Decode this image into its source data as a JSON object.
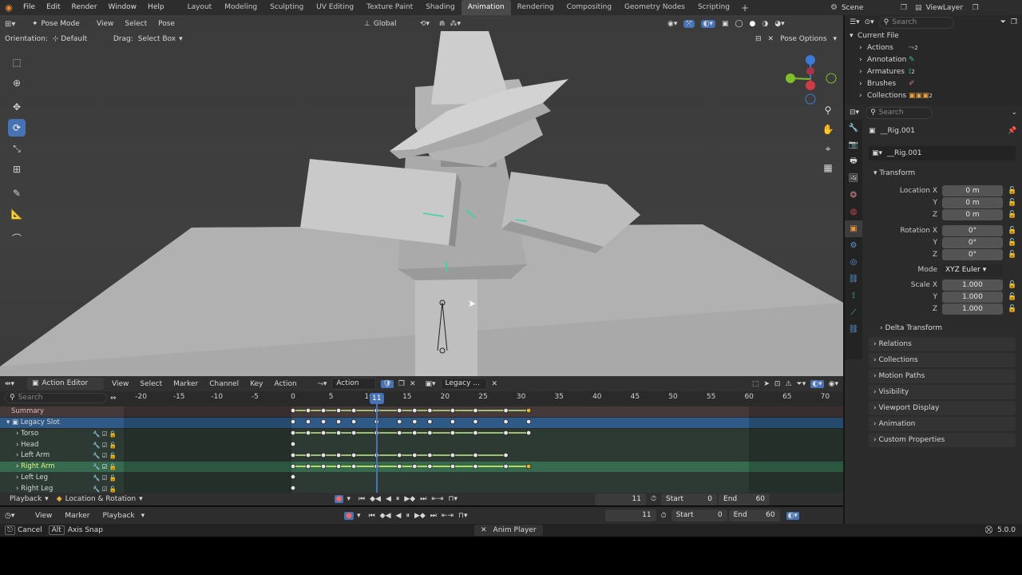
{
  "menu": [
    "File",
    "Edit",
    "Render",
    "Window",
    "Help"
  ],
  "workspaces": [
    "Layout",
    "Modeling",
    "Sculpting",
    "UV Editing",
    "Texture Paint",
    "Shading",
    "Animation",
    "Rendering",
    "Compositing",
    "Geometry Nodes",
    "Scripting"
  ],
  "active_workspace": "Animation",
  "scene": "Scene",
  "view_layer": "ViewLayer",
  "viewport": {
    "mode": "Pose Mode",
    "menus": [
      "View",
      "Select",
      "Pose"
    ],
    "orientation_label": "Orientation:",
    "orientation": "Default",
    "drag_label": "Drag:",
    "drag": "Select Box",
    "transform_orient": "Global",
    "pose_options": "Pose Options"
  },
  "outliner": {
    "search_placeholder": "Search",
    "root": "Current File",
    "items": [
      {
        "label": "Actions",
        "count": "2"
      },
      {
        "label": "Annotation",
        "count": ""
      },
      {
        "label": "Armatures",
        "count": "2"
      },
      {
        "label": "Brushes",
        "count": ""
      },
      {
        "label": "Collections",
        "count": "2"
      }
    ]
  },
  "properties": {
    "search_placeholder": "Search",
    "object": "__Rig.001",
    "data": "__Rig.001",
    "transform": "Transform",
    "location_label": "Location X",
    "rotation_label": "Rotation X",
    "y": "Y",
    "z": "Z",
    "x_scale": "Scale X",
    "loc": [
      "0 m",
      "0 m",
      "0 m"
    ],
    "rot": [
      "0°",
      "0°",
      "0°"
    ],
    "mode_label": "Mode",
    "mode": "XYZ Euler",
    "scale": [
      "1.000",
      "1.000",
      "1.000"
    ],
    "delta": "Delta Transform",
    "panels": [
      "Relations",
      "Collections",
      "Motion Paths",
      "Visibility",
      "Viewport Display",
      "Animation",
      "Custom Properties"
    ]
  },
  "action_editor": {
    "editor": "Action Editor",
    "menus": [
      "View",
      "Select",
      "Marker",
      "Channel",
      "Key",
      "Action"
    ],
    "action": "Action",
    "slot": "Legacy ...",
    "search_placeholder": "Search",
    "ruler": [
      "-20",
      "-15",
      "-10",
      "-5",
      "0",
      "5",
      "10",
      "15",
      "20",
      "25",
      "30",
      "35",
      "40",
      "45",
      "50",
      "55",
      "60",
      "65",
      "70"
    ],
    "current_frame": "11",
    "summary": "Summary",
    "slot_row": "Legacy Slot",
    "channels": [
      "Torso",
      "Head",
      "Left Arm",
      "Right Arm",
      "Left Leg",
      "Right Leg"
    ],
    "playback": "Playback",
    "keying": "Location & Rotation",
    "frame": "11",
    "start_label": "Start",
    "start": "0",
    "end_label": "End",
    "end": "60"
  },
  "timeline": {
    "menus": [
      "View",
      "Marker",
      "Playback"
    ],
    "frame": "11",
    "start": "0",
    "end": "60"
  },
  "status": {
    "cancel": "Cancel",
    "alt": "Alt",
    "axis_snap": "Axis Snap",
    "center": "Anim Player",
    "version": "5.0.0"
  }
}
